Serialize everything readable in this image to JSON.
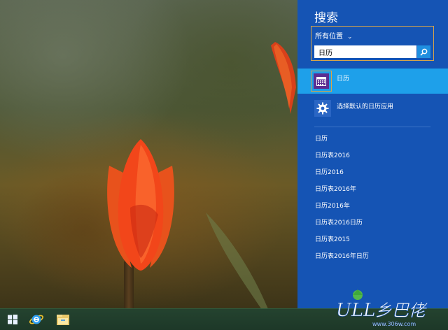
{
  "search_panel": {
    "title": "搜索",
    "scope_label": "所有位置",
    "query_value": "日历",
    "top_result": {
      "label": "日历",
      "icon": "calendar-icon"
    },
    "settings_result": {
      "label": "选择默认的日历应用",
      "icon": "gear-icon"
    },
    "suggestions": [
      "日历",
      "日历表2016",
      "日历2016",
      "日历表2016年",
      "日历2016年",
      "日历表2016日历",
      "日历表2015",
      "日历表2016年日历"
    ]
  },
  "watermark": {
    "text": "ULL乡巴佬",
    "url": "www.306w.com"
  },
  "taskbar": {
    "items": [
      "windows-logo-icon",
      "internet-explorer-icon",
      "file-explorer-icon"
    ]
  },
  "colors": {
    "panel_bg": "#1554b4",
    "selected_result_bg": "#1ea0ea",
    "highlight_border": "#d7a449",
    "calendar_tile": "#5b2d91"
  }
}
